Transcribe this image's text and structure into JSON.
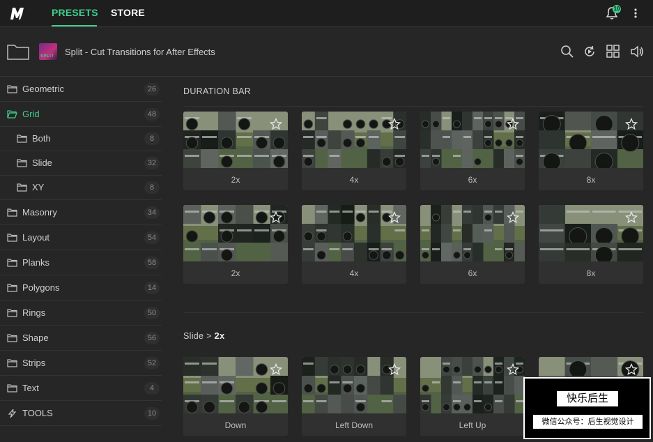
{
  "header": {
    "tabs": [
      {
        "label": "PRESETS"
      },
      {
        "label": "STORE"
      }
    ],
    "notification_count": "10"
  },
  "product": {
    "title": "Split - Cut Transitions for After Effects",
    "thumb_text": "SPLIT"
  },
  "sidebar": {
    "items": [
      {
        "label": "Geometric",
        "count": "26"
      },
      {
        "label": "Grid",
        "count": "48"
      },
      {
        "label": "Both",
        "count": "8"
      },
      {
        "label": "Slide",
        "count": "32"
      },
      {
        "label": "XY",
        "count": "8"
      },
      {
        "label": "Masonry",
        "count": "34"
      },
      {
        "label": "Layout",
        "count": "54"
      },
      {
        "label": "Planks",
        "count": "58"
      },
      {
        "label": "Polygons",
        "count": "14"
      },
      {
        "label": "Rings",
        "count": "50"
      },
      {
        "label": "Shape",
        "count": "56"
      },
      {
        "label": "Strips",
        "count": "52"
      },
      {
        "label": "Text",
        "count": "4"
      },
      {
        "label": "TOOLS",
        "count": "10"
      }
    ]
  },
  "main": {
    "section1_title": "DURATION BAR",
    "row1": [
      "2x",
      "4x",
      "6x",
      "8x"
    ],
    "row2": [
      "2x",
      "4x",
      "6x",
      "8x"
    ],
    "section2_breadcrumb_prefix": "Slide > ",
    "section2_breadcrumb_current": "2x",
    "row3": [
      "Down",
      "Left Down",
      "Left Up",
      ""
    ]
  },
  "watermark": {
    "top": "快乐后生",
    "bottom": "微信公众号：后生视觉设计"
  },
  "colors": {
    "accent": "#3ecf8e",
    "background": "#262626"
  }
}
